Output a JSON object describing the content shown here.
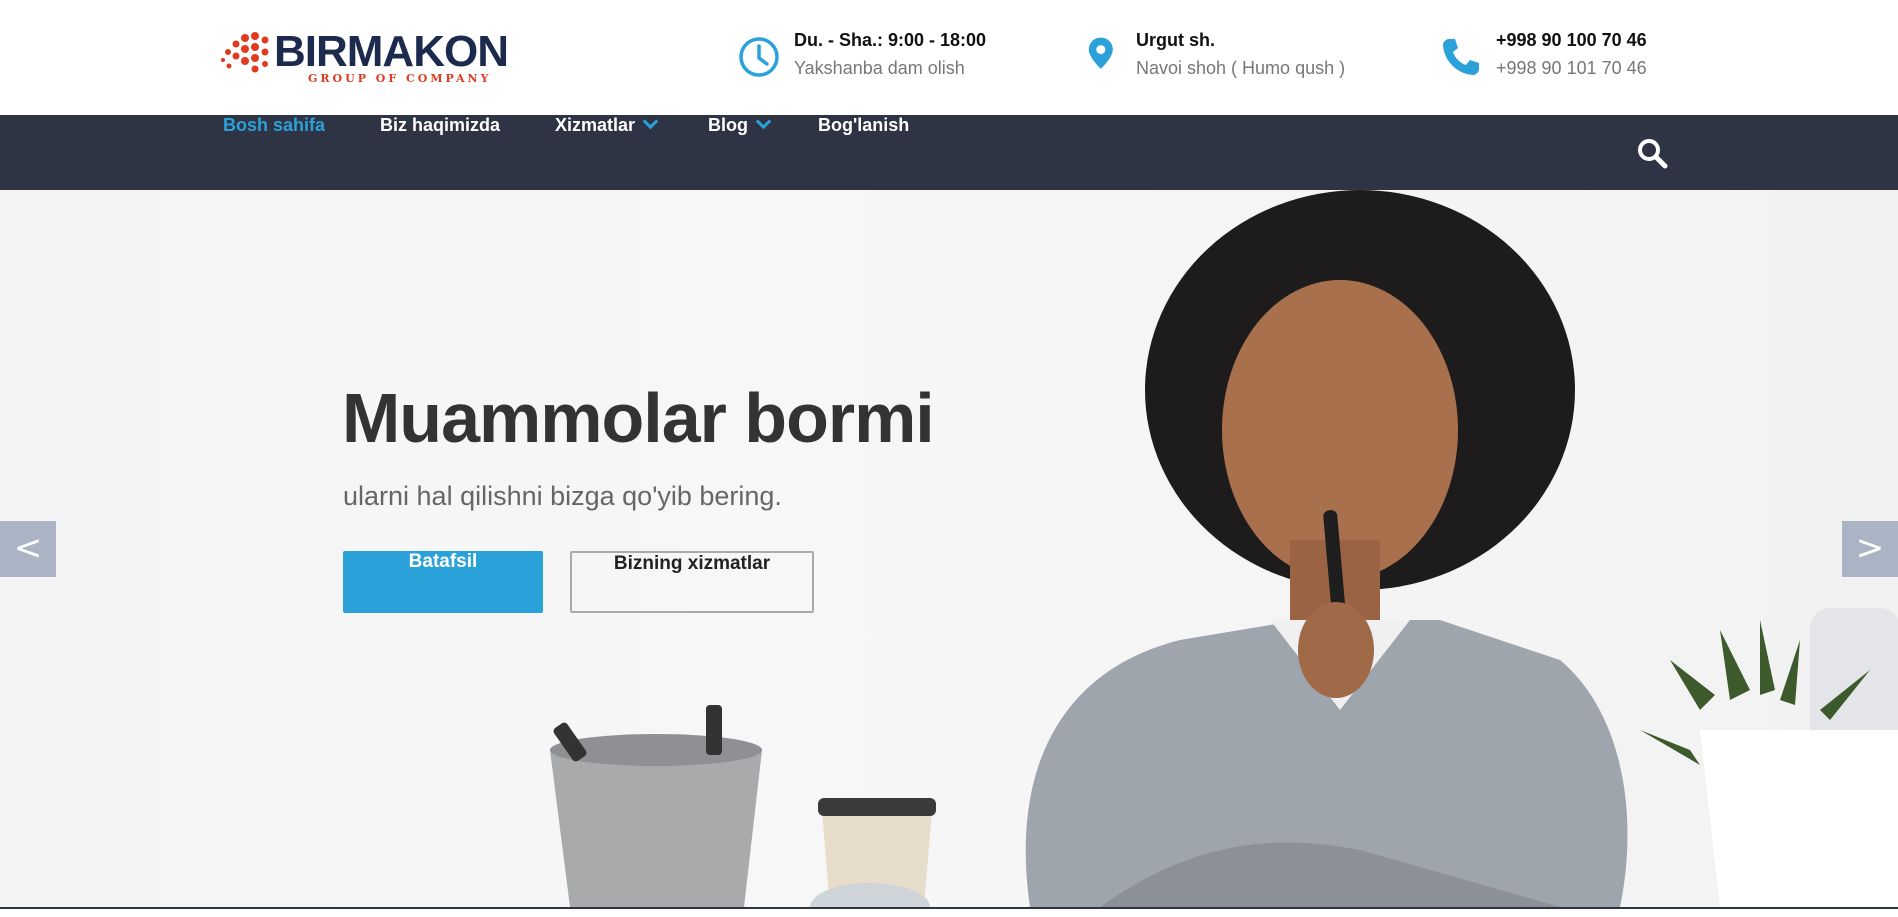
{
  "brand": {
    "name": "BIRMAKON",
    "tagline": "GROUP OF COMPANY",
    "colors": {
      "navy": "#1c2a4e",
      "red": "#e03b1f"
    }
  },
  "header": {
    "hours": {
      "icon": "clock-icon",
      "title": "Du. - Sha.: 9:00 - 18:00",
      "subtitle": "Yakshanba dam olish"
    },
    "address": {
      "icon": "map-pin-icon",
      "title": "Urgut sh.",
      "subtitle": "Navoi shoh ( Humo qush )"
    },
    "phone": {
      "icon": "phone-icon",
      "title": "+998  90 100 70 46",
      "subtitle": "+998  90 101 70 46"
    }
  },
  "nav": {
    "items": [
      {
        "label": "Bosh sahifa",
        "active": true
      },
      {
        "label": "Biz haqimizda"
      },
      {
        "label": "Xizmatlar",
        "dropdown": true
      },
      {
        "label": "Blog",
        "dropdown": true
      },
      {
        "label": "Bog'lanish"
      }
    ],
    "search_icon": "search-icon"
  },
  "hero": {
    "title": "Muammolar bormi",
    "subtitle": "ularni hal qilishni bizga qo'yib bering.",
    "primary_button": "Batafsil",
    "secondary_button": "Bizning xizmatlar",
    "prev_label": "<",
    "next_label": ">"
  },
  "colors": {
    "accent": "#2aa1d9",
    "nav_bg": "#2e3443",
    "arrow_bg": "#aab4c4"
  }
}
